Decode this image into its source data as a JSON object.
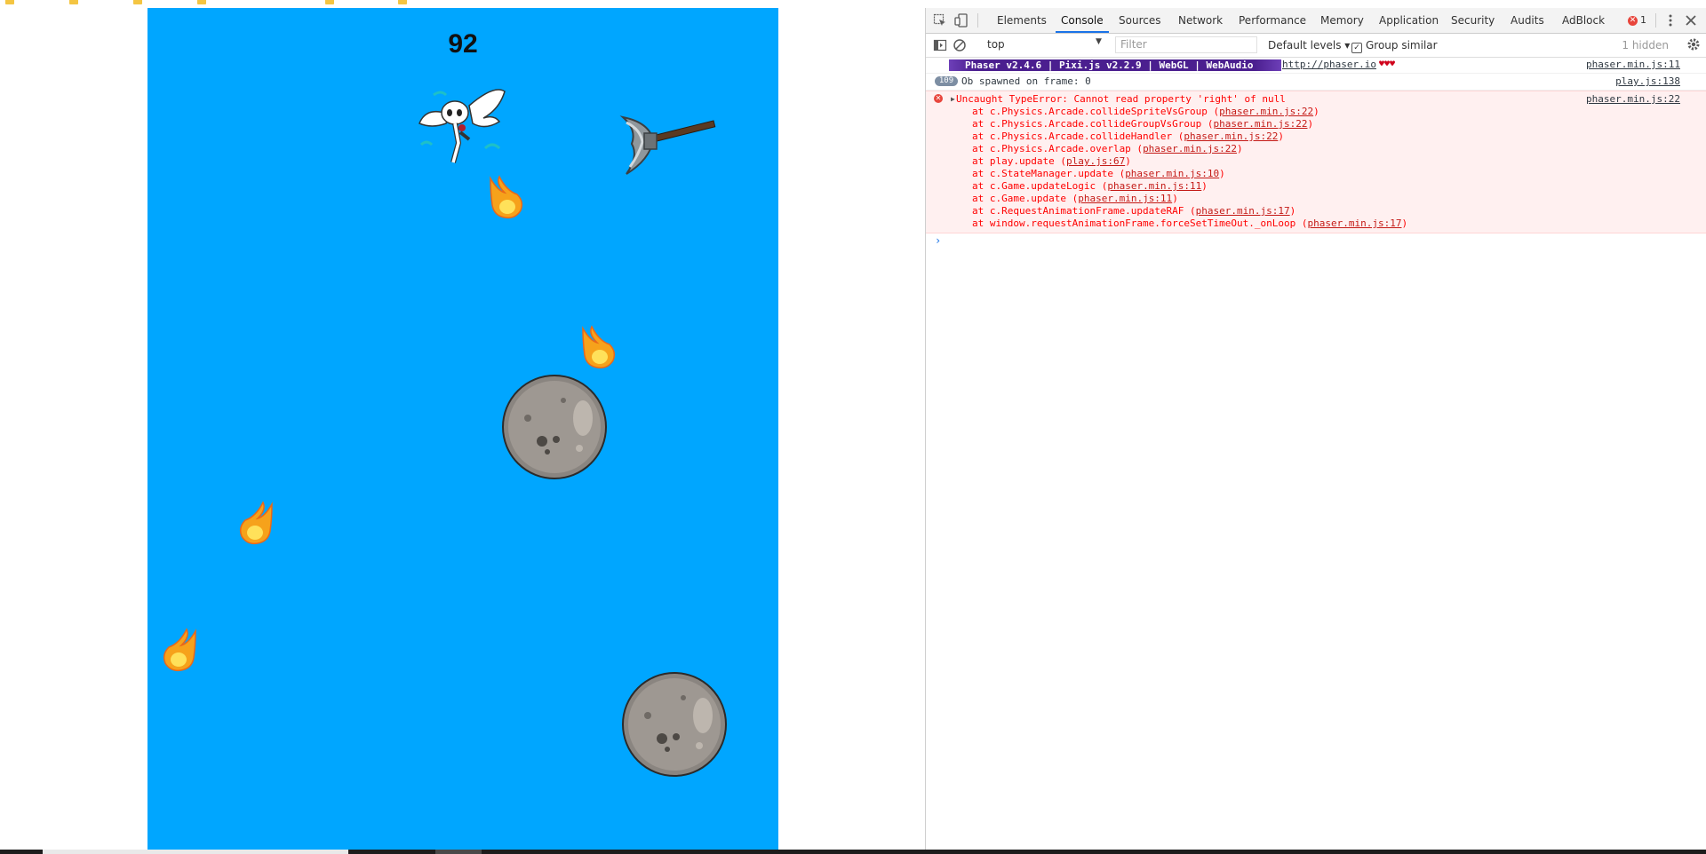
{
  "game": {
    "score": "92"
  },
  "devtools": {
    "tabs": [
      {
        "label": "Elements"
      },
      {
        "label": "Console"
      },
      {
        "label": "Sources"
      },
      {
        "label": "Network"
      },
      {
        "label": "Performance"
      },
      {
        "label": "Memory"
      },
      {
        "label": "Application"
      },
      {
        "label": "Security"
      },
      {
        "label": "Audits"
      },
      {
        "label": "AdBlock"
      }
    ],
    "active_tab": "Console",
    "error_count": "1",
    "toolbar": {
      "context": "top",
      "filter_placeholder": "Filter",
      "levels": "Default levels ▾",
      "group_similar": "Group similar",
      "hidden": "1 hidden"
    },
    "messages": {
      "banner": "Phaser v2.4.6 | Pixi.js v2.2.9 | WebGL | WebAudio",
      "banner_link": "http://phaser.io",
      "banner_hearts": "♥♥♥",
      "banner_source": "phaser.min.js:11",
      "repeat_count": "109",
      "log_text": "Ob spawned on frame: 0",
      "log_source": "play.js:138",
      "error_title": "Uncaught TypeError: Cannot read property 'right' of null",
      "error_source": "phaser.min.js:22",
      "stack": [
        {
          "fn": "at c.Physics.Arcade.collideSpriteVsGroup (",
          "file": "phaser.min.js:22",
          "end": ")"
        },
        {
          "fn": "at c.Physics.Arcade.collideGroupVsGroup (",
          "file": "phaser.min.js:22",
          "end": ")"
        },
        {
          "fn": "at c.Physics.Arcade.collideHandler (",
          "file": "phaser.min.js:22",
          "end": ")"
        },
        {
          "fn": "at c.Physics.Arcade.overlap (",
          "file": "phaser.min.js:22",
          "end": ")"
        },
        {
          "fn": "at play.update (",
          "file": "play.js:67",
          "end": ")"
        },
        {
          "fn": "at c.StateManager.update (",
          "file": "phaser.min.js:10",
          "end": ")"
        },
        {
          "fn": "at c.Game.updateLogic (",
          "file": "phaser.min.js:11",
          "end": ")"
        },
        {
          "fn": "at c.Game.update (",
          "file": "phaser.min.js:11",
          "end": ")"
        },
        {
          "fn": "at c.RequestAnimationFrame.updateRAF (",
          "file": "phaser.min.js:17",
          "end": ")"
        },
        {
          "fn": "at window.requestAnimationFrame.forceSetTimeOut._onLoop (",
          "file": "phaser.min.js:17",
          "end": ")"
        }
      ],
      "prompt": "›"
    }
  },
  "colors": {
    "game_sky": "#00a6ff",
    "error_bg": "#fff0f0",
    "error_text": "#ff0000",
    "banner_purple": "#4b1f8f"
  }
}
